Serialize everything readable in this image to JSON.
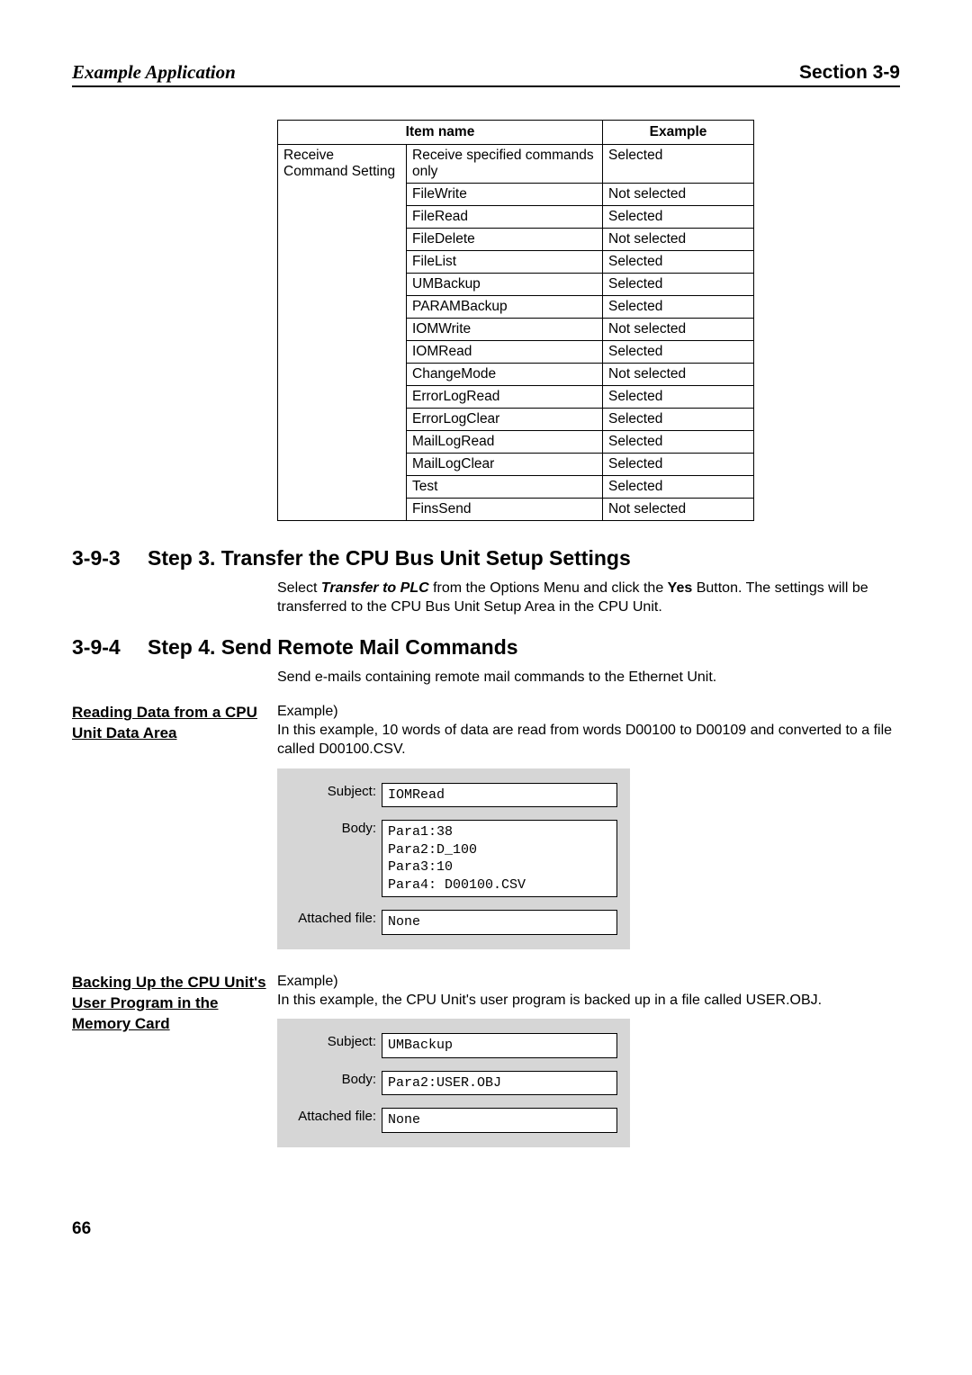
{
  "header": {
    "left": "Example Application",
    "right": "Section 3-9"
  },
  "table": {
    "head": {
      "col1": "Item name",
      "col2": "Example"
    },
    "group_label": "Receive Command Setting",
    "rows": [
      {
        "name": "Receive specified commands only",
        "example": "Selected"
      },
      {
        "name": "FileWrite",
        "example": "Not selected"
      },
      {
        "name": "FileRead",
        "example": "Selected"
      },
      {
        "name": "FileDelete",
        "example": "Not selected"
      },
      {
        "name": "FileList",
        "example": "Selected"
      },
      {
        "name": "UMBackup",
        "example": "Selected"
      },
      {
        "name": "PARAMBackup",
        "example": "Selected"
      },
      {
        "name": "IOMWrite",
        "example": "Not selected"
      },
      {
        "name": "IOMRead",
        "example": "Selected"
      },
      {
        "name": "ChangeMode",
        "example": "Not selected"
      },
      {
        "name": "ErrorLogRead",
        "example": "Selected"
      },
      {
        "name": "ErrorLogClear",
        "example": "Selected"
      },
      {
        "name": "MailLogRead",
        "example": "Selected"
      },
      {
        "name": "MailLogClear",
        "example": "Selected"
      },
      {
        "name": "Test",
        "example": "Selected"
      },
      {
        "name": "FinsSend",
        "example": "Not selected"
      }
    ]
  },
  "s393": {
    "num": "3-9-3",
    "title": "Step 3. Transfer the CPU Bus Unit Setup Settings",
    "body_pre": "Select ",
    "body_b1": "Transfer to PLC",
    "body_mid": " from the Options Menu and click the ",
    "body_b2": "Yes",
    "body_post": " Button. The settings will be transferred to the CPU Bus Unit Setup Area in the CPU Unit."
  },
  "s394": {
    "num": "3-9-4",
    "title": "Step 4. Send Remote Mail Commands",
    "body": "Send e-mails containing remote mail commands to the Ethernet Unit."
  },
  "ex1": {
    "left": "Reading Data from a CPU Unit Data Area",
    "lead": "Example)",
    "desc": "In this example, 10 words of data are read from words D00100 to D00109 and converted to a file called D00100.CSV.",
    "labels": {
      "subject": "Subject:",
      "body": "Body:",
      "attached": "Attached file:"
    },
    "vals": {
      "subject": "IOMRead",
      "body": "Para1:38\nPara2:D_100\nPara3:10\nPara4: D00100.CSV",
      "attached": "None"
    }
  },
  "ex2": {
    "left": "Backing Up the CPU Unit's User Program in the Memory Card",
    "lead": "Example)",
    "desc": "In this example, the CPU Unit's user program is backed up in a file called USER.OBJ.",
    "labels": {
      "subject": "Subject:",
      "body": "Body:",
      "attached": "Attached file:"
    },
    "vals": {
      "subject": "UMBackup",
      "body": "Para2:USER.OBJ",
      "attached": "None"
    }
  },
  "page": "66"
}
